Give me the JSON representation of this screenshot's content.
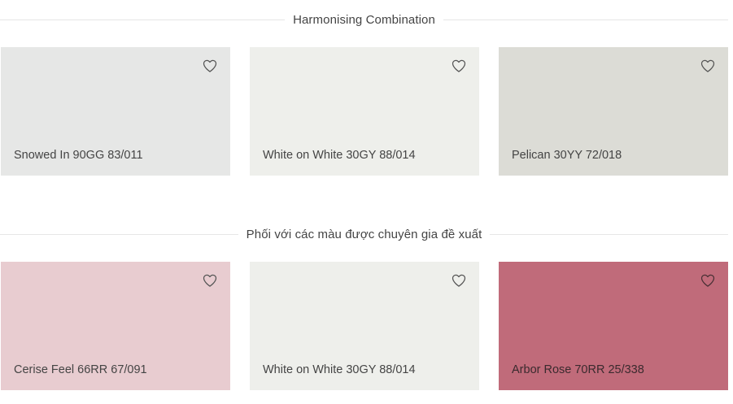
{
  "sections": [
    {
      "title": "Harmonising Combination",
      "cards": [
        {
          "name": "Snowed In 90GG 83/011",
          "color": "#e6e7e6"
        },
        {
          "name": "White on White 30GY 88/014",
          "color": "#eeefeb"
        },
        {
          "name": "Pelican 30YY 72/018",
          "color": "#dcdcd6"
        }
      ]
    },
    {
      "title": "Phối với các màu được chuyên gia đề xuất",
      "cards": [
        {
          "name": "Cerise Feel 66RR 67/091",
          "color": "#e8ccd0"
        },
        {
          "name": "White on White 30GY 88/014",
          "color": "#eeefeb"
        },
        {
          "name": "Arbor Rose 70RR 25/338",
          "color": "#c06b7a"
        }
      ]
    }
  ],
  "icons": {
    "favorite": "heart-outline-icon"
  }
}
